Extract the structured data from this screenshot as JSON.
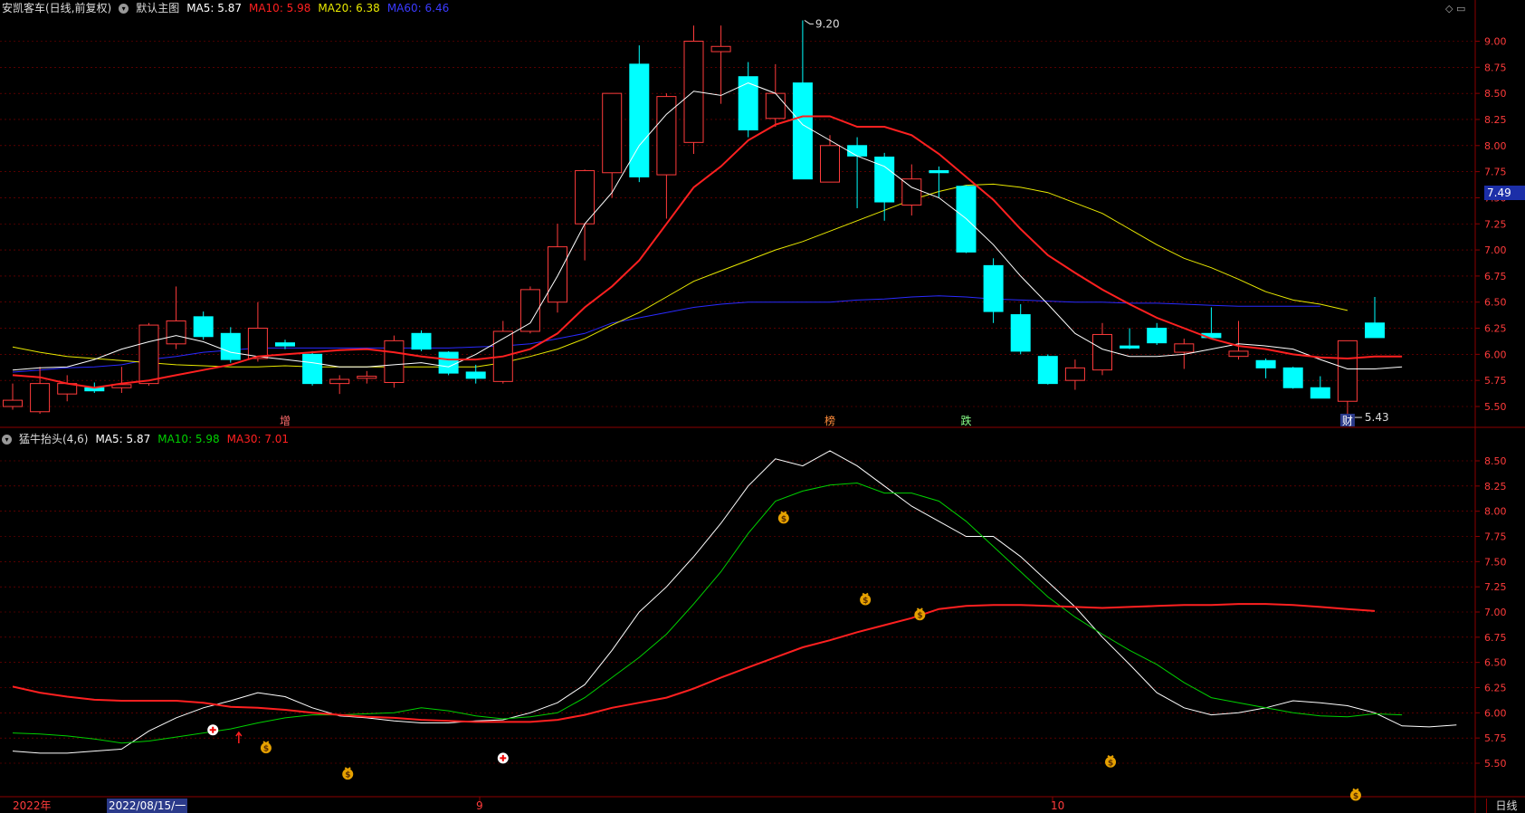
{
  "main_legend": {
    "title": "安凯客车(日线,前复权)",
    "panel_name": "默认主图",
    "ma5": "MA5: 5.87",
    "ma10": "MA10: 5.98",
    "ma20": "MA20: 6.38",
    "ma60": "MA60: 6.46"
  },
  "sub_legend": {
    "title": "猛牛抬头(4,6)",
    "ma5": "MA5: 5.87",
    "ma10": "MA10: 5.98",
    "ma30": "MA30: 7.01"
  },
  "price_tag": "7.49",
  "tab_label": "日线",
  "x_labels": {
    "year": "2022年",
    "cursor_date": "2022/08/15/一",
    "sep": "9",
    "oct": "10"
  },
  "colors": {
    "up": "#ff3b3b",
    "down": "#00ffff",
    "ma5": "#ffffff",
    "ma10": "#ff2020",
    "ma20": "#e8e800",
    "ma60": "#2a2aff",
    "sub_ma5": "#ffffff",
    "sub_ma10": "#00d000",
    "sub_ma30": "#ff2020",
    "grid": "#8b0000"
  },
  "chart_data": [
    {
      "type": "candlestick",
      "y_ticks": [
        "5.50",
        "5.75",
        "6.00",
        "6.25",
        "6.50",
        "6.75",
        "7.00",
        "7.25",
        "7.50",
        "7.75",
        "8.00",
        "8.25",
        "8.50",
        "8.75",
        "9.00"
      ],
      "ylim": [
        5.4,
        9.3
      ],
      "candles": [
        {
          "o": 5.5,
          "h": 5.72,
          "l": 5.47,
          "c": 5.56
        },
        {
          "o": 5.45,
          "h": 5.88,
          "l": 5.43,
          "c": 5.72
        },
        {
          "o": 5.62,
          "h": 5.8,
          "l": 5.55,
          "c": 5.72
        },
        {
          "o": 5.68,
          "h": 5.73,
          "l": 5.63,
          "c": 5.65
        },
        {
          "o": 5.68,
          "h": 5.88,
          "l": 5.63,
          "c": 5.71
        },
        {
          "o": 5.72,
          "h": 6.3,
          "l": 5.7,
          "c": 6.28
        },
        {
          "o": 6.1,
          "h": 6.65,
          "l": 6.05,
          "c": 6.32
        },
        {
          "o": 6.36,
          "h": 6.41,
          "l": 6.14,
          "c": 6.17
        },
        {
          "o": 6.2,
          "h": 6.26,
          "l": 5.92,
          "c": 5.95
        },
        {
          "o": 5.96,
          "h": 6.5,
          "l": 5.93,
          "c": 6.25
        },
        {
          "o": 6.11,
          "h": 6.14,
          "l": 6.05,
          "c": 6.08
        },
        {
          "o": 6.0,
          "h": 6.03,
          "l": 5.7,
          "c": 5.72
        },
        {
          "o": 5.72,
          "h": 5.8,
          "l": 5.62,
          "c": 5.76
        },
        {
          "o": 5.77,
          "h": 5.84,
          "l": 5.72,
          "c": 5.79
        },
        {
          "o": 5.73,
          "h": 6.18,
          "l": 5.68,
          "c": 6.13
        },
        {
          "o": 6.2,
          "h": 6.23,
          "l": 6.03,
          "c": 6.05
        },
        {
          "o": 6.02,
          "h": 6.03,
          "l": 5.8,
          "c": 5.82
        },
        {
          "o": 5.83,
          "h": 5.9,
          "l": 5.72,
          "c": 5.77
        },
        {
          "o": 5.74,
          "h": 6.32,
          "l": 5.72,
          "c": 6.22
        },
        {
          "o": 6.22,
          "h": 6.65,
          "l": 6.2,
          "c": 6.62
        },
        {
          "o": 6.5,
          "h": 7.25,
          "l": 6.4,
          "c": 7.03
        },
        {
          "o": 7.25,
          "h": 7.77,
          "l": 6.9,
          "c": 7.76
        },
        {
          "o": 7.74,
          "h": 8.5,
          "l": 7.5,
          "c": 8.5
        },
        {
          "o": 8.78,
          "h": 8.96,
          "l": 7.65,
          "c": 7.7
        },
        {
          "o": 7.72,
          "h": 8.5,
          "l": 7.3,
          "c": 8.47
        },
        {
          "o": 8.03,
          "h": 9.15,
          "l": 7.92,
          "c": 9.0
        },
        {
          "o": 8.9,
          "h": 9.15,
          "l": 8.4,
          "c": 8.95
        },
        {
          "o": 8.66,
          "h": 8.8,
          "l": 8.08,
          "c": 8.15
        },
        {
          "o": 8.26,
          "h": 8.78,
          "l": 8.18,
          "c": 8.5
        },
        {
          "o": 8.6,
          "h": 9.2,
          "l": 7.7,
          "c": 7.68
        },
        {
          "o": 7.65,
          "h": 8.1,
          "l": 7.65,
          "c": 8.0
        },
        {
          "o": 8.0,
          "h": 8.08,
          "l": 7.4,
          "c": 7.9
        },
        {
          "o": 7.89,
          "h": 7.93,
          "l": 7.28,
          "c": 7.46
        },
        {
          "o": 7.43,
          "h": 7.82,
          "l": 7.33,
          "c": 7.68
        },
        {
          "o": 7.76,
          "h": 7.8,
          "l": 7.5,
          "c": 7.74
        },
        {
          "o": 7.61,
          "h": 7.62,
          "l": 6.97,
          "c": 6.98
        },
        {
          "o": 6.85,
          "h": 6.92,
          "l": 6.3,
          "c": 6.41
        },
        {
          "o": 6.38,
          "h": 6.48,
          "l": 6.0,
          "c": 6.03
        },
        {
          "o": 5.98,
          "h": 6.0,
          "l": 5.71,
          "c": 5.72
        },
        {
          "o": 5.75,
          "h": 5.95,
          "l": 5.66,
          "c": 5.87
        },
        {
          "o": 5.85,
          "h": 6.3,
          "l": 5.8,
          "c": 6.19
        },
        {
          "o": 6.08,
          "h": 6.25,
          "l": 6.05,
          "c": 6.06
        },
        {
          "o": 6.25,
          "h": 6.3,
          "l": 6.09,
          "c": 6.11
        },
        {
          "o": 6.02,
          "h": 6.15,
          "l": 5.86,
          "c": 6.1
        },
        {
          "o": 6.2,
          "h": 6.45,
          "l": 6.16,
          "c": 6.16
        },
        {
          "o": 5.98,
          "h": 6.32,
          "l": 5.95,
          "c": 6.03
        },
        {
          "o": 5.94,
          "h": 5.96,
          "l": 5.77,
          "c": 5.87
        },
        {
          "o": 5.87,
          "h": 5.88,
          "l": 5.67,
          "c": 5.68
        },
        {
          "o": 5.68,
          "h": 5.79,
          "l": 5.58,
          "c": 5.58
        },
        {
          "o": 5.55,
          "h": 6.13,
          "l": 5.43,
          "c": 6.13
        },
        {
          "o": 6.3,
          "h": 6.55,
          "l": 6.16,
          "c": 6.16
        }
      ],
      "ma5": [
        5.85,
        5.87,
        5.88,
        5.95,
        6.05,
        6.12,
        6.18,
        6.12,
        6.02,
        5.98,
        5.95,
        5.92,
        5.88,
        5.88,
        5.9,
        5.92,
        5.88,
        6.0,
        6.15,
        6.3,
        6.75,
        7.25,
        7.55,
        8.0,
        8.3,
        8.52,
        8.48,
        8.6,
        8.5,
        8.2,
        8.05,
        7.9,
        7.8,
        7.6,
        7.5,
        7.3,
        7.05,
        6.75,
        6.48,
        6.2,
        6.05,
        5.98,
        5.98,
        6.0,
        6.05,
        6.1,
        6.08,
        6.05,
        5.95,
        5.86,
        5.86,
        5.88
      ],
      "ma10": [
        5.8,
        5.78,
        5.72,
        5.68,
        5.72,
        5.75,
        5.8,
        5.85,
        5.9,
        5.98,
        6.0,
        6.02,
        6.04,
        6.05,
        6.02,
        5.98,
        5.95,
        5.95,
        5.98,
        6.05,
        6.2,
        6.45,
        6.65,
        6.9,
        7.25,
        7.6,
        7.8,
        8.05,
        8.2,
        8.28,
        8.28,
        8.18,
        8.18,
        8.1,
        7.92,
        7.7,
        7.48,
        7.2,
        6.95,
        6.78,
        6.62,
        6.48,
        6.35,
        6.25,
        6.15,
        6.08,
        6.05,
        6.0,
        5.97,
        5.96,
        5.98,
        5.98
      ],
      "ma20": [
        6.07,
        6.02,
        5.98,
        5.96,
        5.94,
        5.92,
        5.9,
        5.89,
        5.88,
        5.88,
        5.89,
        5.88,
        5.88,
        5.88,
        5.88,
        5.88,
        5.88,
        5.88,
        5.92,
        5.98,
        6.05,
        6.15,
        6.28,
        6.4,
        6.55,
        6.7,
        6.8,
        6.9,
        7.0,
        7.08,
        7.18,
        7.28,
        7.38,
        7.48,
        7.56,
        7.62,
        7.63,
        7.6,
        7.55,
        7.45,
        7.35,
        7.2,
        7.05,
        6.92,
        6.83,
        6.72,
        6.6,
        6.52,
        6.48,
        6.42
      ],
      "ma60": [
        5.83,
        5.85,
        5.87,
        5.88,
        5.9,
        5.95,
        5.98,
        6.02,
        6.04,
        6.06,
        6.06,
        6.06,
        6.06,
        6.06,
        6.06,
        6.06,
        6.06,
        6.07,
        6.08,
        6.1,
        6.15,
        6.2,
        6.3,
        6.35,
        6.4,
        6.45,
        6.48,
        6.5,
        6.5,
        6.5,
        6.5,
        6.52,
        6.53,
        6.55,
        6.56,
        6.55,
        6.53,
        6.52,
        6.51,
        6.5,
        6.5,
        6.49,
        6.49,
        6.48,
        6.47,
        6.46,
        6.46,
        6.46,
        6.46
      ],
      "annotations": [
        {
          "i": 29,
          "text": "9.20",
          "anchor": "high"
        },
        {
          "i": 49,
          "text": "5.43",
          "anchor": "low"
        }
      ],
      "markers": [
        {
          "i": 10,
          "text": "增",
          "color": "#ff6b6b"
        },
        {
          "i": 30,
          "text": "榜",
          "color": "#ff8c3a"
        },
        {
          "i": 35,
          "text": "跌",
          "color": "#88ff88"
        },
        {
          "i": 49,
          "text": "财",
          "color": "#ffffff",
          "bg": "#2b3a8a"
        }
      ]
    },
    {
      "type": "line",
      "y_ticks": [
        "5.50",
        "5.75",
        "6.00",
        "6.25",
        "6.50",
        "6.75",
        "7.00",
        "7.25",
        "7.50",
        "7.75",
        "8.00",
        "8.25",
        "8.50"
      ],
      "ylim": [
        5.3,
        8.8
      ],
      "series": [
        {
          "name": "MA5",
          "values": [
            5.62,
            5.6,
            5.6,
            5.62,
            5.64,
            5.82,
            5.95,
            6.05,
            6.12,
            6.2,
            6.16,
            6.05,
            5.97,
            5.95,
            5.92,
            5.9,
            5.9,
            5.92,
            5.93,
            6.0,
            6.1,
            6.28,
            6.62,
            7.0,
            7.25,
            7.55,
            7.88,
            8.25,
            8.52,
            8.45,
            8.6,
            8.45,
            8.25,
            8.05,
            7.9,
            7.75,
            7.75,
            7.55,
            7.3,
            7.05,
            6.75,
            6.48,
            6.2,
            6.05,
            5.98,
            6.0,
            6.05,
            6.12,
            6.1,
            6.07,
            6.0,
            5.87,
            5.86,
            5.88
          ]
        },
        {
          "name": "MA10",
          "values": [
            5.8,
            5.79,
            5.77,
            5.74,
            5.7,
            5.72,
            5.76,
            5.8,
            5.84,
            5.9,
            5.95,
            5.98,
            5.98,
            5.99,
            6.0,
            6.05,
            6.02,
            5.97,
            5.94,
            5.96,
            6.0,
            6.15,
            6.35,
            6.55,
            6.78,
            7.08,
            7.4,
            7.78,
            8.1,
            8.2,
            8.26,
            8.28,
            8.18,
            8.18,
            8.1,
            7.9,
            7.65,
            7.4,
            7.15,
            6.95,
            6.78,
            6.62,
            6.48,
            6.3,
            6.15,
            6.1,
            6.05,
            6.0,
            5.97,
            5.96,
            5.99,
            5.98
          ]
        },
        {
          "name": "MA30",
          "values": [
            6.26,
            6.2,
            6.16,
            6.13,
            6.12,
            6.12,
            6.12,
            6.1,
            6.06,
            6.05,
            6.03,
            6.0,
            5.98,
            5.96,
            5.95,
            5.93,
            5.92,
            5.91,
            5.91,
            5.91,
            5.93,
            5.98,
            6.05,
            6.1,
            6.15,
            6.24,
            6.35,
            6.45,
            6.55,
            6.65,
            6.72,
            6.8,
            6.87,
            6.94,
            7.03,
            7.06,
            7.07,
            7.07,
            7.06,
            7.05,
            7.04,
            7.05,
            7.06,
            7.07,
            7.07,
            7.08,
            7.08,
            7.07,
            7.05,
            7.03,
            7.01
          ]
        }
      ],
      "signals": [
        {
          "x": 7.35,
          "y": 5.83,
          "kind": "cross"
        },
        {
          "x": 18.0,
          "y": 5.55,
          "kind": "cross"
        },
        {
          "x": 8.3,
          "y": 5.76,
          "kind": "arrow"
        },
        {
          "x": 9.3,
          "y": 5.66,
          "kind": "bag"
        },
        {
          "x": 12.3,
          "y": 5.4,
          "kind": "bag"
        },
        {
          "x": 28.3,
          "y": 7.94,
          "kind": "bag"
        },
        {
          "x": 31.3,
          "y": 7.13,
          "kind": "bag"
        },
        {
          "x": 33.3,
          "y": 6.98,
          "kind": "bag"
        },
        {
          "x": 40.3,
          "y": 5.52,
          "kind": "bag"
        },
        {
          "x": 49.3,
          "y": 5.19,
          "kind": "bag"
        }
      ]
    }
  ]
}
